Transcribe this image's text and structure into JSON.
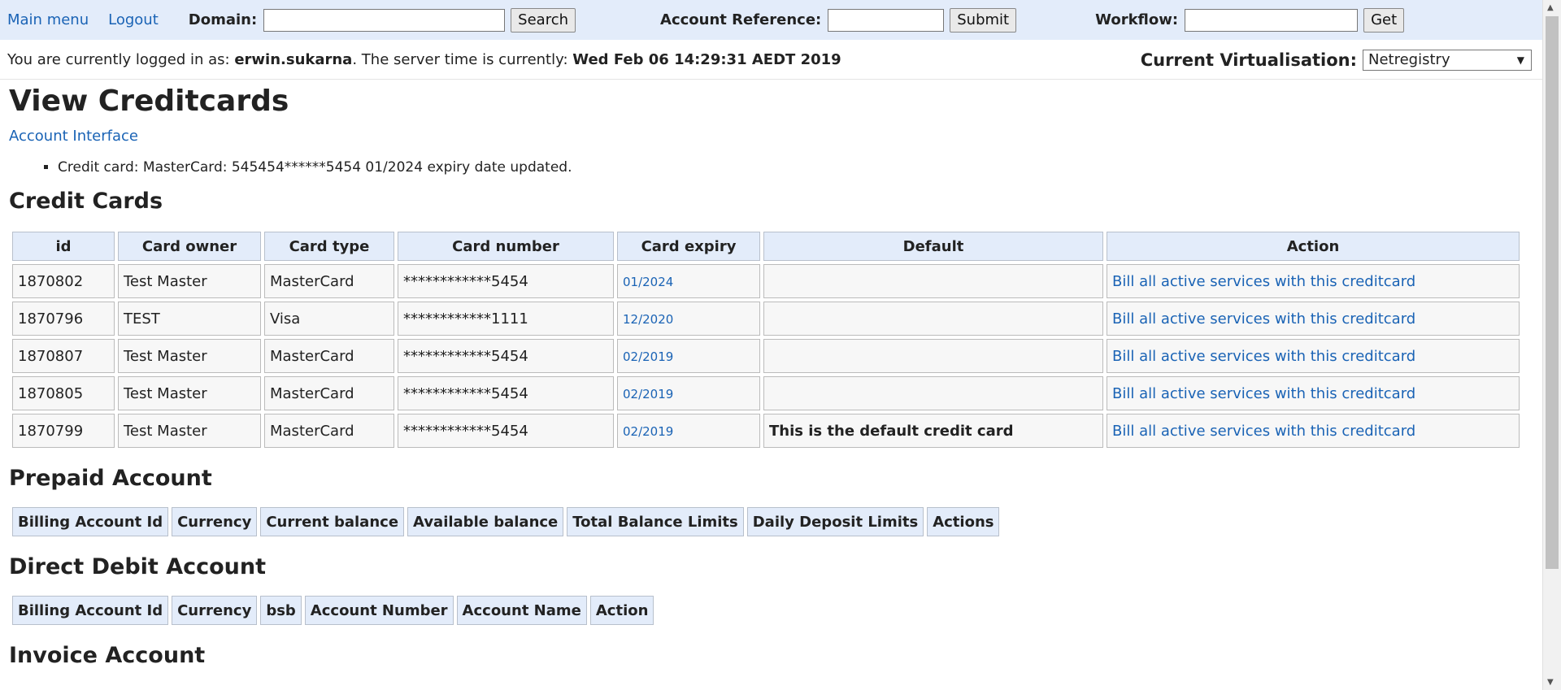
{
  "topbar": {
    "main_menu": "Main menu",
    "logout": "Logout",
    "domain_label": "Domain:",
    "domain_value": "",
    "search_button": "Search",
    "account_ref_label": "Account Reference:",
    "account_ref_value": "",
    "submit_button": "Submit",
    "workflow_label": "Workflow:",
    "workflow_value": "",
    "get_button": "Get"
  },
  "userbar": {
    "prefix": "You are currently logged in as: ",
    "username": "erwin.sukarna",
    "middle": ". The server time is currently: ",
    "server_time": "Wed Feb 06 14:29:31 AEDT 2019",
    "virtualisation_label": "Current Virtualisation:",
    "virtualisation_value": "Netregistry"
  },
  "page": {
    "title": "View Creditcards",
    "account_interface_link": "Account Interface",
    "messages": [
      "Credit card: MasterCard: 545454******5454 01/2024 expiry date updated."
    ]
  },
  "credit_cards": {
    "heading": "Credit Cards",
    "columns": [
      "id",
      "Card owner",
      "Card type",
      "Card number",
      "Card expiry",
      "Default",
      "Action"
    ],
    "rows": [
      {
        "id": "1870802",
        "owner": "Test Master",
        "type": "MasterCard",
        "number": "************5454",
        "expiry": "01/2024",
        "default": "",
        "action": "Bill all active services with this creditcard"
      },
      {
        "id": "1870796",
        "owner": "TEST",
        "type": "Visa",
        "number": "************1111",
        "expiry": "12/2020",
        "default": "",
        "action": "Bill all active services with this creditcard"
      },
      {
        "id": "1870807",
        "owner": "Test Master",
        "type": "MasterCard",
        "number": "************5454",
        "expiry": "02/2019",
        "default": "",
        "action": "Bill all active services with this creditcard"
      },
      {
        "id": "1870805",
        "owner": "Test Master",
        "type": "MasterCard",
        "number": "************5454",
        "expiry": "02/2019",
        "default": "",
        "action": "Bill all active services with this creditcard"
      },
      {
        "id": "1870799",
        "owner": "Test Master",
        "type": "MasterCard",
        "number": "************5454",
        "expiry": "02/2019",
        "default": "This is the default credit card",
        "action": "Bill all active services with this creditcard"
      }
    ]
  },
  "prepaid": {
    "heading": "Prepaid Account",
    "columns": [
      "Billing Account Id",
      "Currency",
      "Current balance",
      "Available balance",
      "Total Balance Limits",
      "Daily Deposit Limits",
      "Actions"
    ]
  },
  "direct_debit": {
    "heading": "Direct Debit Account",
    "columns": [
      "Billing Account Id",
      "Currency",
      "bsb",
      "Account Number",
      "Account Name",
      "Action"
    ]
  },
  "invoice": {
    "heading": "Invoice Account"
  },
  "colors": {
    "header_bg": "#e3ecfa",
    "link": "#1a63b5"
  }
}
